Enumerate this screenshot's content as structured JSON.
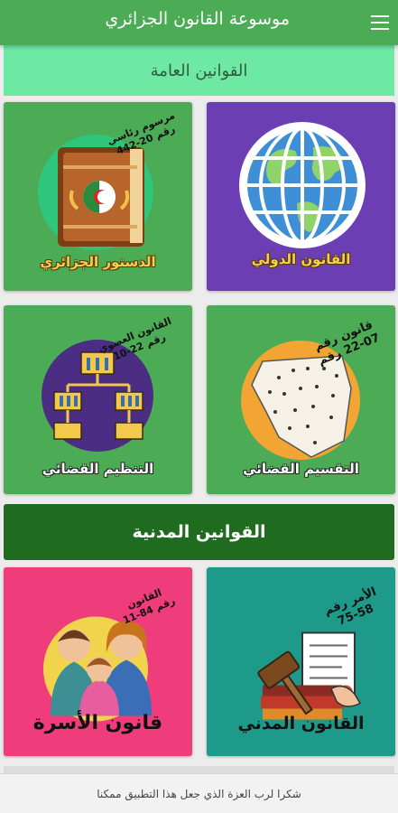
{
  "app": {
    "title": "موسوعة القانون الجزائري",
    "menu_icon": "menu-icon"
  },
  "sections": {
    "general": "القوانين العامة",
    "civil": "القوانين المدنية"
  },
  "tiles": {
    "international": {
      "label": "القانون الدولي",
      "color": "#6b3fb3",
      "icon": "globe-icon"
    },
    "constitution": {
      "label": "الدستور الجزائري",
      "color": "#4cab55",
      "icon": "constitution-book-icon",
      "corner": [
        "مرسوم رئاسي",
        "رقم 20-442"
      ]
    },
    "judicial_division": {
      "label": "التقسيم القضائي",
      "color": "#4cab55",
      "icon": "algeria-map-icon",
      "corner": [
        "قانون رقم",
        "22-07 رقم"
      ]
    },
    "judicial_organization": {
      "label": "التنظيم القضائي",
      "color": "#4cab55",
      "icon": "courts-hierarchy-icon",
      "corner": [
        "القانون العضوي",
        "رقم 22-10"
      ]
    },
    "civil_law": {
      "label": "القانون المدني",
      "color": "#1e9a8b",
      "icon": "gavel-contract-icon",
      "corner": [
        "الأمر رقم",
        "75-58"
      ]
    },
    "family_law": {
      "label": "قانون الأسرة",
      "color": "#ef3c7a",
      "icon": "family-icon",
      "corner": [
        "القانون",
        "رقم 84-11"
      ]
    }
  },
  "footer": {
    "text": "شكرا لرب العزة الذي جعل هذا التطبيق ممكنا"
  }
}
